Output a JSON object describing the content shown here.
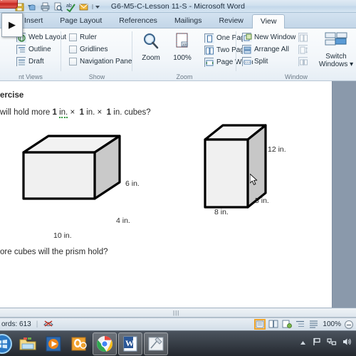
{
  "window": {
    "title": "G6-M5-C-Lesson 11-S  -  Microsoft Word",
    "quick_access_icons": [
      "save-icon",
      "undo-icon",
      "print-icon",
      "print-preview-icon",
      "spelling-icon",
      "email-icon",
      "customize-qat-icon"
    ],
    "close_button": "close-icon"
  },
  "overlay_popup": {
    "glyph": "▶",
    "name": "play-arrow"
  },
  "tabs": [
    {
      "label": "Insert",
      "active": false
    },
    {
      "label": "Page Layout",
      "active": false
    },
    {
      "label": "References",
      "active": false
    },
    {
      "label": "Mailings",
      "active": false
    },
    {
      "label": "Review",
      "active": false
    },
    {
      "label": "View",
      "active": true
    }
  ],
  "ribbon": {
    "groups": [
      {
        "label": "nt Views",
        "commands": [
          {
            "label": "Web Layout",
            "icon": "web-layout-icon"
          },
          {
            "label": "Outline",
            "icon": "outline-icon"
          },
          {
            "label": "Draft",
            "icon": "draft-icon"
          }
        ]
      },
      {
        "label": "Show",
        "commands": [
          {
            "label": "Ruler",
            "icon": "ruler-checkbox"
          },
          {
            "label": "Gridlines",
            "icon": "gridlines-checkbox"
          },
          {
            "label": "Navigation Pane",
            "icon": "navigation-pane-checkbox"
          }
        ]
      },
      {
        "label": "Zoom",
        "commands": [
          {
            "label": "Zoom",
            "icon": "magnifier-icon"
          },
          {
            "label": "100%",
            "icon": "zoom-100-icon"
          },
          {
            "label": "One Page",
            "icon": "one-page-icon"
          },
          {
            "label": "Two Pages",
            "icon": "two-pages-icon"
          },
          {
            "label": "Page Width",
            "icon": "page-width-icon"
          }
        ]
      },
      {
        "label": "Window",
        "commands": [
          {
            "label": "New Window",
            "icon": "new-window-icon"
          },
          {
            "label": "Arrange All",
            "icon": "arrange-all-icon"
          },
          {
            "label": "Split",
            "icon": "split-icon"
          },
          {
            "label": "Switch Windows ▾",
            "icon": "switch-windows-icon"
          }
        ]
      }
    ]
  },
  "document": {
    "heading": "ercise",
    "question_1": {
      "prefix": "will hold more ",
      "n1": "1",
      "u1": "in.",
      "times1": "×",
      "n2": "1",
      "u2": "in.",
      "times2": "×",
      "n3": "1",
      "u3": "in.",
      "suffix": "cubes?"
    },
    "question_2": "ore cubes will the prism hold?",
    "figures": [
      {
        "name": "rectangular-prism-left",
        "length": "10 in.",
        "depth": "4 in.",
        "height": "6 in."
      },
      {
        "name": "rectangular-prism-right",
        "length": "8 in.",
        "depth": "5 in.",
        "height": "12 in."
      }
    ]
  },
  "statusbar": {
    "word_count": "ords: 613",
    "proofing_icon": "proofing-errors-icon",
    "view_buttons": [
      "print-layout-view",
      "full-screen-reading-view",
      "web-layout-view",
      "outline-view",
      "draft-view"
    ],
    "zoom_level": "100%",
    "zoom_out": "zoom-out-icon"
  },
  "taskbar": {
    "start": "start-orb",
    "items": [
      {
        "name": "windows-explorer-icon",
        "active": false
      },
      {
        "name": "media-player-icon",
        "active": false
      },
      {
        "name": "office-outlook-icon",
        "active": false
      },
      {
        "name": "google-chrome-icon",
        "active": true
      },
      {
        "name": "microsoft-word-icon",
        "active": true
      },
      {
        "name": "snipping-tool-icon",
        "active": true
      }
    ],
    "tray": [
      "show-hidden-icons-icon",
      "action-center-flag-icon",
      "network-icon",
      "volume-icon"
    ]
  },
  "colors": {
    "accent": "#f0a52b",
    "titlebar": "#cfe0ee",
    "page": "#ffffff",
    "canvas": "#8a99ab"
  }
}
